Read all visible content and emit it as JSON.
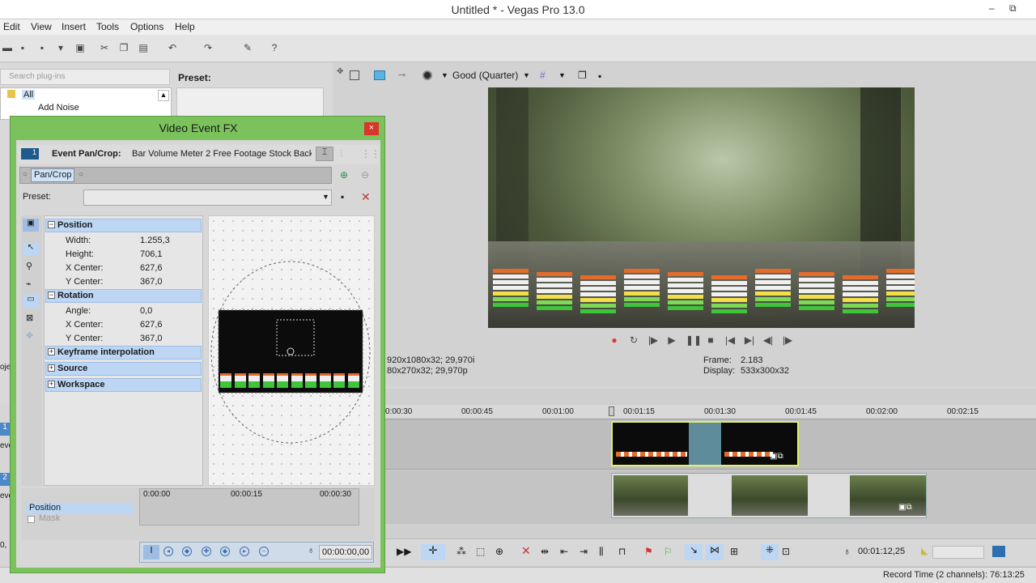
{
  "window": {
    "title": "Untitled * - Vegas Pro 13.0",
    "minimize": "–",
    "restore": "⧉"
  },
  "menu": [
    "Edit",
    "View",
    "Insert",
    "Tools",
    "Options",
    "Help"
  ],
  "plugins": {
    "search_placeholder": "Search plug-ins",
    "tree": [
      "All",
      "Add Noise"
    ],
    "preset_label": "Preset:"
  },
  "preview": {
    "quality": "Good (Quarter)",
    "project_info": "920x1080x32; 29,970i",
    "preview_info": "80x270x32; 29,970p",
    "frame_label": "Frame:",
    "frame_value": "2.183",
    "display_label": "Display:",
    "display_value": "533x300x32"
  },
  "timeline": {
    "ruler": [
      "0:00:30",
      "00:00:45",
      "00:01:00",
      "00:01:15",
      "00:01:30",
      "00:01:45",
      "00:02:00",
      "00:02:15"
    ],
    "track_numbers": [
      "1",
      "2"
    ],
    "track_label_clip": "eve",
    "cursor_time": "00:01:12,25",
    "side_label_proj": "oje",
    "side_label_0": "0,"
  },
  "status": {
    "record_time": "Record Time (2 channels): 76:13:25"
  },
  "fx": {
    "title": "Video Event FX",
    "close": "×",
    "header_chip": "1",
    "header_label": "Event Pan/Crop:",
    "header_source": "Bar Volume Meter 2 Free Footage Stock Back",
    "chain_chip": "Pan/Crop",
    "preset_label": "Preset:",
    "sections": {
      "position": "Position",
      "rotation": "Rotation",
      "keyframe": "Keyframe interpolation",
      "source": "Source",
      "workspace": "Workspace"
    },
    "position_props": [
      {
        "k": "Width:",
        "v": "1.255,3"
      },
      {
        "k": "Height:",
        "v": "706,1"
      },
      {
        "k": "X Center:",
        "v": "627,6"
      },
      {
        "k": "Y Center:",
        "v": "367,0"
      }
    ],
    "rotation_props": [
      {
        "k": "Angle:",
        "v": "0,0"
      },
      {
        "k": "X Center:",
        "v": "627,6"
      },
      {
        "k": "Y Center:",
        "v": "367,0"
      }
    ],
    "kf_ruler": [
      "0:00:00",
      "00:00:15",
      "00:00:30"
    ],
    "kf_tracks": [
      "Position",
      "Mask"
    ],
    "timecode": "00:00:00,00"
  },
  "colors": {
    "dialog_frame": "#7cc25c",
    "section_bg": "#bcd6f4",
    "clip_border": "#e1f16a",
    "close_red": "#d9352b"
  }
}
